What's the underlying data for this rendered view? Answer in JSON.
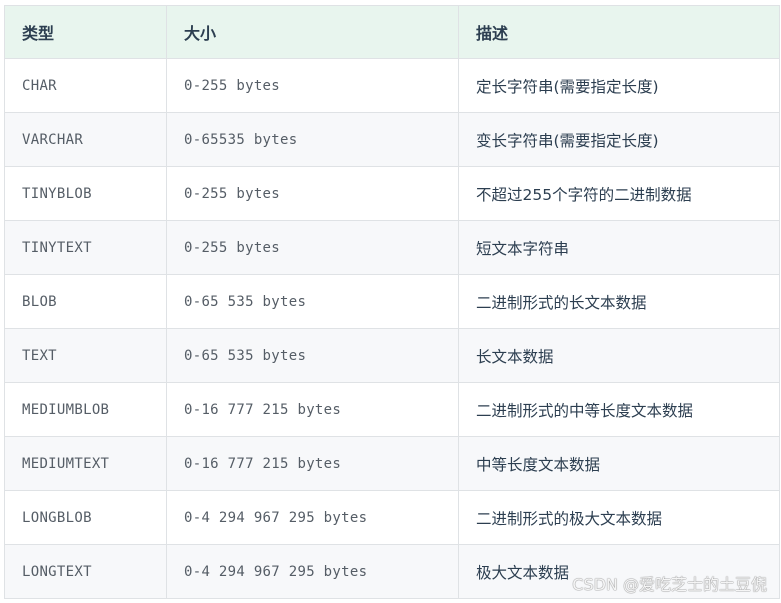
{
  "table": {
    "headers": [
      "类型",
      "大小",
      "描述"
    ],
    "rows": [
      {
        "type": "CHAR",
        "size": "0-255 bytes",
        "desc": "定长字符串(需要指定长度)"
      },
      {
        "type": "VARCHAR",
        "size": "0-65535 bytes",
        "desc": "变长字符串(需要指定长度)"
      },
      {
        "type": "TINYBLOB",
        "size": "0-255 bytes",
        "desc": "不超过255个字符的二进制数据"
      },
      {
        "type": "TINYTEXT",
        "size": "0-255 bytes",
        "desc": "短文本字符串"
      },
      {
        "type": "BLOB",
        "size": "0-65 535 bytes",
        "desc": "二进制形式的长文本数据"
      },
      {
        "type": "TEXT",
        "size": "0-65 535 bytes",
        "desc": "长文本数据"
      },
      {
        "type": "MEDIUMBLOB",
        "size": "0-16 777 215 bytes",
        "desc": "二进制形式的中等长度文本数据"
      },
      {
        "type": "MEDIUMTEXT",
        "size": "0-16 777 215 bytes",
        "desc": "中等长度文本数据"
      },
      {
        "type": "LONGBLOB",
        "size": "0-4 294 967 295 bytes",
        "desc": "二进制形式的极大文本数据"
      },
      {
        "type": "LONGTEXT",
        "size": "0-4 294 967 295 bytes",
        "desc": "极大文本数据"
      }
    ]
  },
  "watermark": "CSDN @爱吃芝士的土豆倪"
}
